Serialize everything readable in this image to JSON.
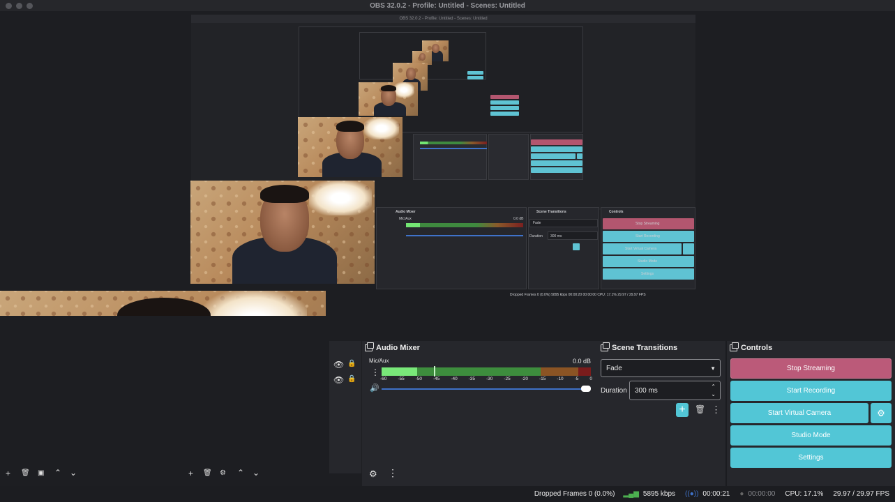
{
  "window": {
    "title": "OBS 32.0.2 - Profile: Untitled - Scenes: Untitled",
    "nested_title": "OBS 32.0.2 - Profile: Untitled - Scenes: Untitled"
  },
  "audio_mixer": {
    "title": "Audio Mixer",
    "channel_name": "Mic/Aux",
    "level_db": "0.0 dB",
    "scale": [
      "-60",
      "-55",
      "-50",
      "-45",
      "-40",
      "-35",
      "-30",
      "-25",
      "-20",
      "-15",
      "-10",
      "-5",
      "0"
    ]
  },
  "scene_transitions": {
    "title": "Scene Transitions",
    "transition": "Fade",
    "duration_label": "Duration",
    "duration_value": "300 ms"
  },
  "controls": {
    "title": "Controls",
    "stop_streaming": "Stop Streaming",
    "start_recording": "Start Recording",
    "start_virtual_camera": "Start Virtual Camera",
    "studio_mode": "Studio Mode",
    "settings": "Settings"
  },
  "nested_controls": {
    "audio_mixer": "Audio Mixer",
    "scene_transitions": "Scene Transitions",
    "controls": "Controls",
    "channel": "Mic/Aux",
    "level": "0.0 dB",
    "transition": "Fade",
    "duration_label": "Duration",
    "duration_value": "300 ms",
    "stop_streaming": "Stop Streaming",
    "start_recording": "Start Recording",
    "start_virtual_camera": "Start Virtual Camera",
    "studio_mode": "Studio Mode",
    "settings": "Settings",
    "status": "Dropped Frames 0 (0.0%)   5895 kbps     00:00:20     00:00:00    CPU: 17.1%    29.97 / 29.97 FPS"
  },
  "status": {
    "dropped_frames": "Dropped Frames 0 (0.0%)",
    "bitrate": "5895 kbps",
    "stream_time": "00:00:21",
    "record_time": "00:00:00",
    "cpu": "CPU: 17.1%",
    "fps": "29.97 / 29.97 FPS"
  },
  "colors": {
    "accent_cyan": "#52c6d6",
    "stop_red": "#bb5a79",
    "meter_green": "#4caf50",
    "meter_red": "#7a2020"
  }
}
